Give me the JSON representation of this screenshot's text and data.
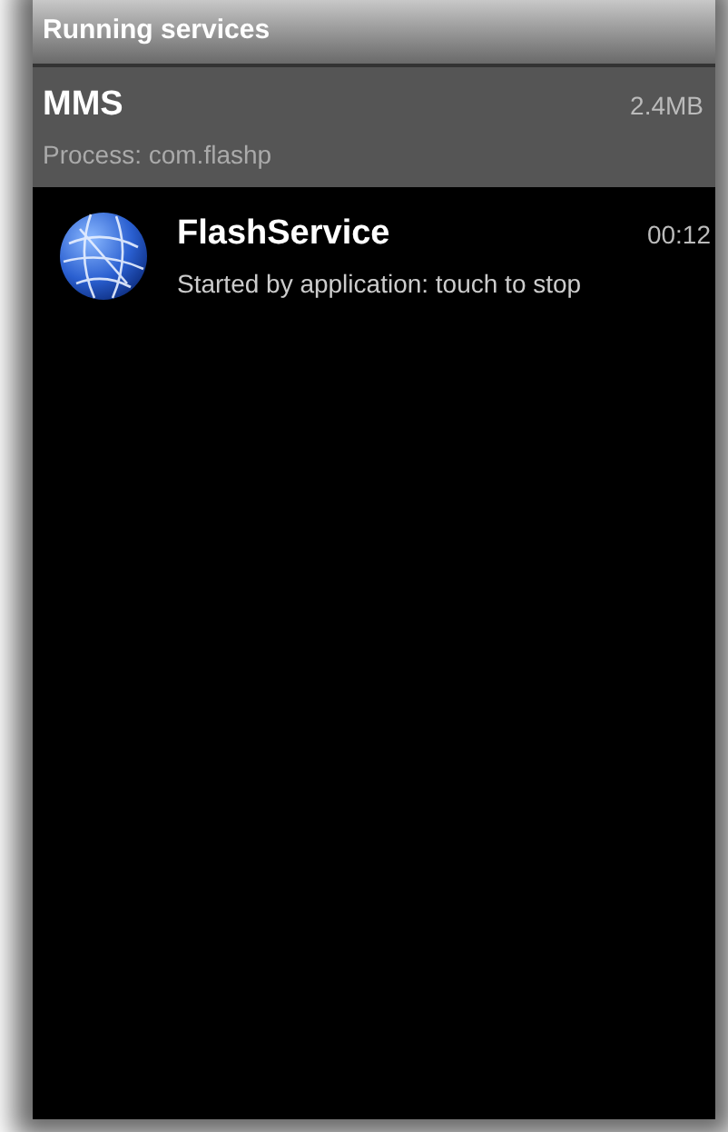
{
  "title_bar": {
    "title": "Running services"
  },
  "process": {
    "name": "MMS",
    "memory": "2.4MB",
    "detail": "Process: com.flashp",
    "selected": true
  },
  "services": [
    {
      "name": "FlashService",
      "time": "00:12",
      "status": "Started by application: touch to stop"
    }
  ]
}
